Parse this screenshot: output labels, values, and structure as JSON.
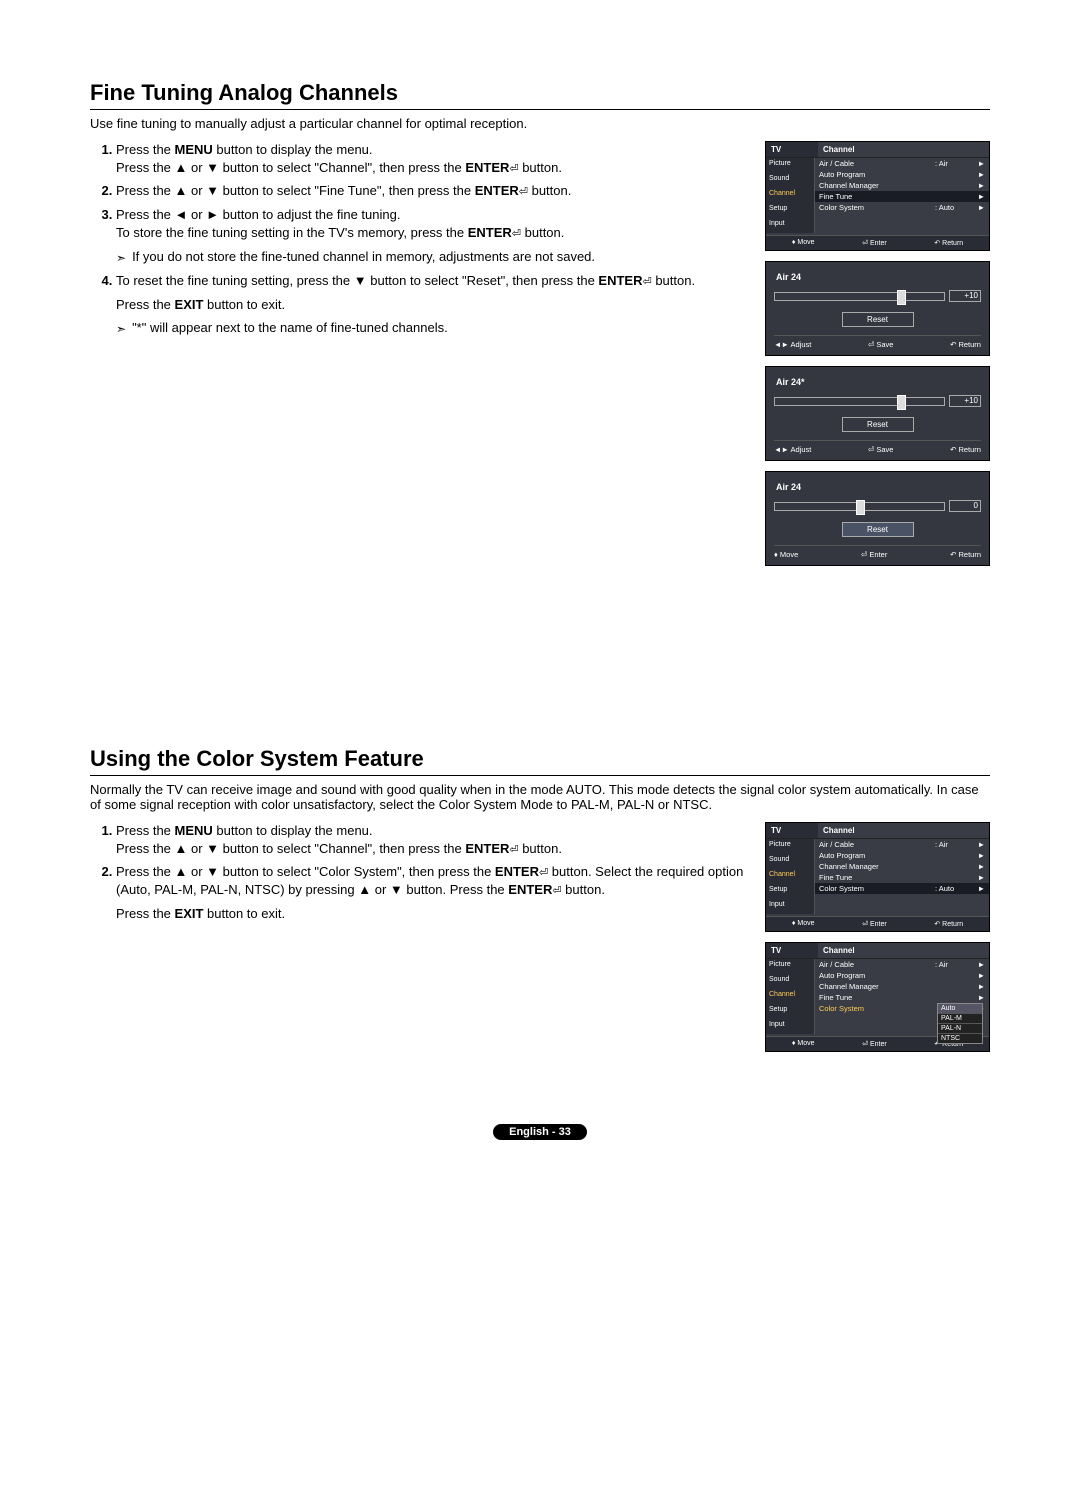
{
  "section1": {
    "heading": "Fine Tuning Analog Channels",
    "intro": "Use fine tuning to manually adjust a particular channel for optimal reception.",
    "step1a": "Press the ",
    "step1b": " button to display the menu.",
    "step1c": "Press the ▲ or ▼ button to select \"Channel\", then press the ",
    "step1d": " button.",
    "step2a": "Press the ▲ or ▼ button to select \"Fine Tune\", then press the ",
    "step2b": " button.",
    "step3a": "Press the ◄ or ► button to adjust the fine tuning.",
    "step3b": "To store the fine tuning setting in the TV's memory, press the ",
    "step3c": " button.",
    "note1": "If you do not store the fine-tuned channel in memory, adjustments are not saved.",
    "step4a": "To reset the fine tuning setting, press the ▼ button to select \"Reset\", then press the ",
    "step4b": " button.",
    "exit1": "Press the ",
    "exit2": " button to exit.",
    "note2": "\"*\" will appear next to the name of fine-tuned channels.",
    "menu_label": "MENU",
    "enter_label": "ENTER",
    "exit_label": "EXIT"
  },
  "section2": {
    "heading": "Using the Color System Feature",
    "intro": "Normally the TV can receive image and sound with good quality when in the mode AUTO. This mode detects the signal color system automatically. In case of some signal reception with color unsatisfactory, select the Color System Mode to PAL-M, PAL-N or NTSC.",
    "step1a": "Press the ",
    "step1b": " button to display the menu.",
    "step1c": "Press the ▲ or ▼ button to select \"Channel\", then press the ",
    "step1d": " button.",
    "step2a": "Press the ▲ or ▼ button to select \"Color System\", then press the ",
    "step2b": " button. Select the required option (Auto, PAL-M, PAL-N, NTSC) by pressing ▲ or ▼ button. Press the ",
    "step2c": " button.",
    "exit1": "Press the ",
    "exit2": " button to exit."
  },
  "tvmenu": {
    "tv": "TV",
    "channel": "Channel",
    "sidebar": [
      "Picture",
      "Sound",
      "Channel",
      "Setup",
      "Input"
    ],
    "items": {
      "aircable": "Air / Cable",
      "aircable_val": ": Air",
      "autoprogram": "Auto Program",
      "chmanager": "Channel Manager",
      "finetune": "Fine Tune",
      "colorsystem": "Color System",
      "colorsystem_val": ": Auto"
    },
    "bottom": {
      "move": "Move",
      "enter": "Enter",
      "return": "Return"
    }
  },
  "ft": {
    "ch1": "Air 24",
    "ch2": "Air 24*",
    "ch3": "Air 24",
    "val10": "+10",
    "val0": "0",
    "reset": "Reset",
    "adjust": "Adjust",
    "save": "Save",
    "return": "Return",
    "move": "Move",
    "enter": "Enter"
  },
  "dropdown": {
    "auto": "Auto",
    "palm": "PAL-M",
    "paln": "PAL-N",
    "ntsc": "NTSC"
  },
  "footer": "English - 33"
}
